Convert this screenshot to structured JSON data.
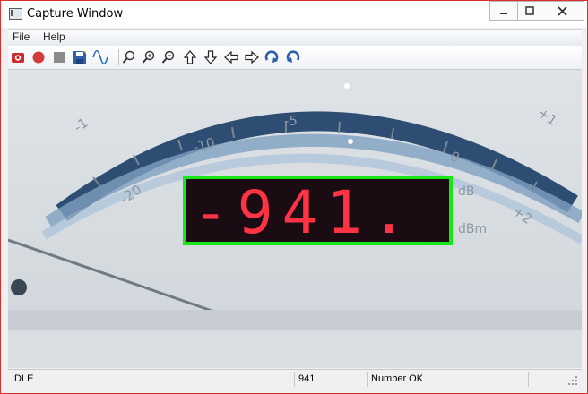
{
  "window": {
    "title": "Capture Window"
  },
  "menu": {
    "items": [
      {
        "label": "File"
      },
      {
        "label": "Help"
      }
    ]
  },
  "toolbar": {
    "icons": [
      "snapshot-icon",
      "record-icon",
      "stop-icon",
      "save-icon",
      "waveform-icon",
      "zoom-icon",
      "zoom-in-icon",
      "zoom-out-icon",
      "arrow-up-icon",
      "arrow-down-icon",
      "arrow-left-icon",
      "arrow-right-icon",
      "rotate-clockwise-icon",
      "rotate-counterclockwise-icon"
    ]
  },
  "display": {
    "reading": "-941.",
    "scale_labels": [
      "-1",
      "-5",
      "-10",
      "-20",
      "0",
      "+1",
      "+2"
    ],
    "units": [
      "dB",
      "dBm"
    ],
    "detection_color": "#19e619",
    "lcd_color": "#ff3344"
  },
  "status": {
    "state": "IDLE",
    "value": "941",
    "message": "Number OK"
  }
}
